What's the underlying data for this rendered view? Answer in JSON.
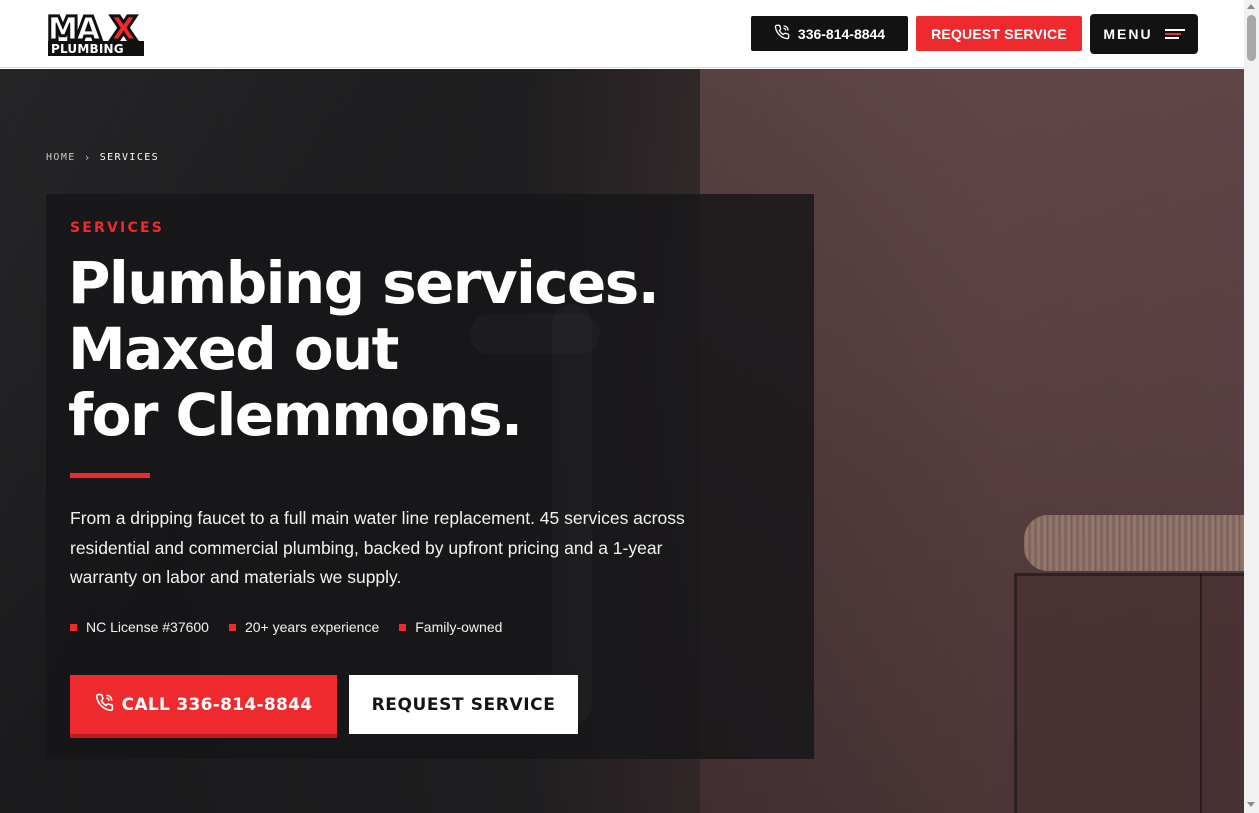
{
  "header": {
    "logo_top": "MAX",
    "logo_bottom": "PLUMBING",
    "phone_label": "336-814-8844",
    "request_label": "REQUEST SERVICE",
    "menu_label": "MENU"
  },
  "breadcrumb": {
    "home": "HOME",
    "current": "SERVICES"
  },
  "hero": {
    "eyebrow": "SERVICES",
    "headline_line1": "Plumbing services.",
    "headline_line2": "Maxed out",
    "headline_line3": "for Clemmons.",
    "lede": "From a dripping faucet to a full main water line replacement. 45 services across residential and commercial plumbing, backed by upfront pricing and a 1-year warranty on labor and materials we supply.",
    "badges": [
      "NC License #37600",
      "20+ years experience",
      "Family-owned"
    ],
    "cta_call": "CALL 336-814-8844",
    "cta_request": "REQUEST SERVICE"
  },
  "colors": {
    "brand_red": "#ee2a2f",
    "dark": "#121212",
    "white": "#ffffff"
  },
  "icons": {
    "phone": "phone-icon",
    "menu": "hamburger-menu-icon",
    "breadcrumb_sep": "chevron-right-icon",
    "badge_marker": "red-square-bullet-icon"
  }
}
